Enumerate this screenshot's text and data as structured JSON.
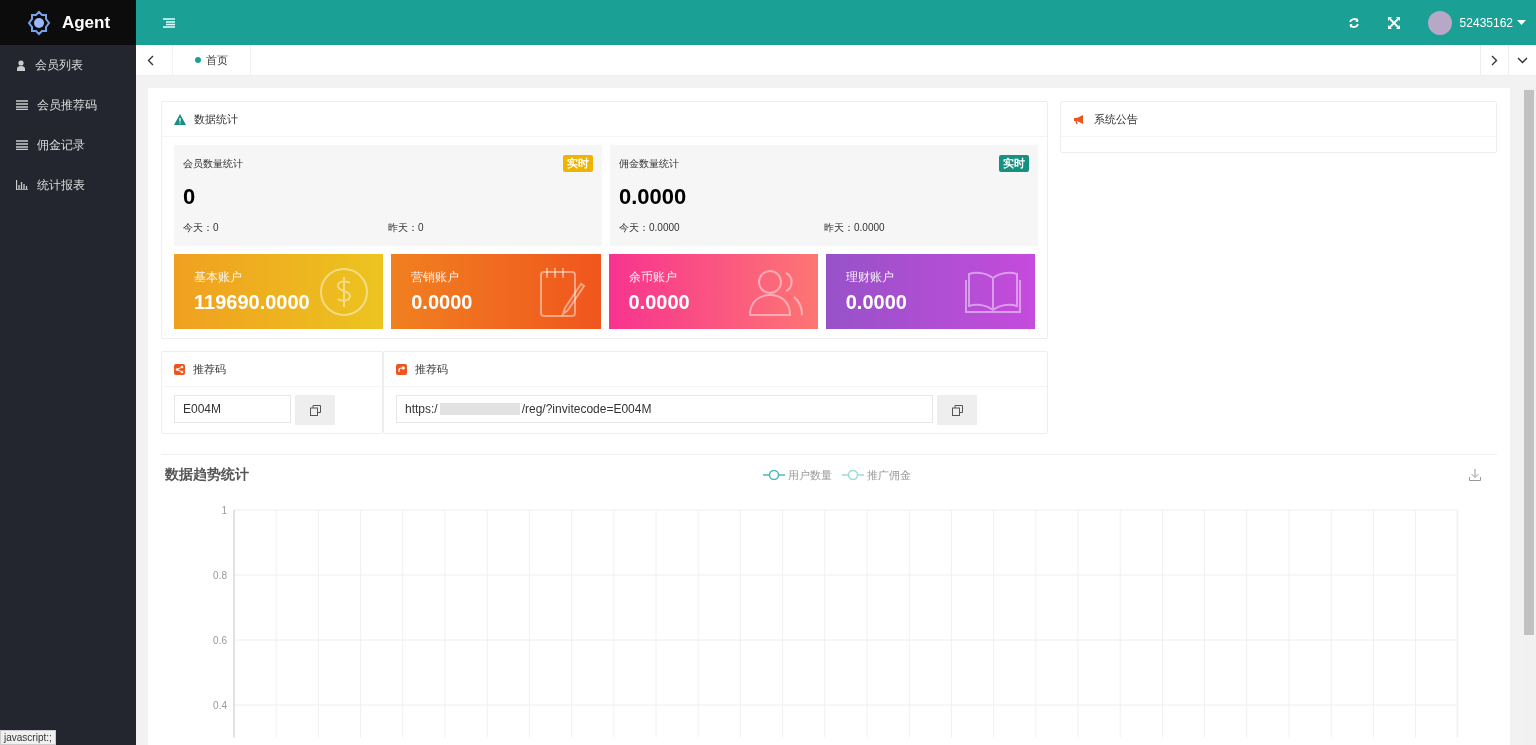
{
  "sidebar": {
    "brand": "Agent",
    "items": [
      {
        "label": "会员列表",
        "kind": "person",
        "selected": false
      },
      {
        "label": "会员推荐码",
        "kind": "list",
        "selected": false
      },
      {
        "label": "佣金记录",
        "kind": "list",
        "selected": false
      },
      {
        "label": "统计报表",
        "kind": "report",
        "selected": false
      }
    ]
  },
  "header": {
    "username": "52435162"
  },
  "tabs": [
    {
      "label": "首页",
      "selected": true
    }
  ],
  "stats_panel": {
    "title": "数据统计",
    "summaries": [
      {
        "title": "会员数量统计",
        "badge": "实时",
        "color": "#f0b400",
        "value": "0",
        "today": "今天：0",
        "yesterday": "昨天：0"
      },
      {
        "title": "佣金数量统计",
        "badge": "实时",
        "color": "#15917f",
        "value": "0.0000",
        "today": "今天：0.0000",
        "yesterday": "昨天：0.0000"
      }
    ],
    "accounts": [
      {
        "label": "基本账户",
        "value": "119690.0000",
        "kind": "coin"
      },
      {
        "label": "营销账户",
        "value": "0.0000",
        "kind": "notebook"
      },
      {
        "label": "余币账户",
        "value": "0.0000",
        "kind": "users"
      },
      {
        "label": "理财账户",
        "value": "0.0000",
        "kind": "book"
      }
    ]
  },
  "notice_panel": {
    "title": "系统公告"
  },
  "referral_code": {
    "title": "推荐码",
    "value": "E004M"
  },
  "referral_link": {
    "title": "推荐码",
    "value_start": "https:/",
    "value_end": "/reg/?invitecode=E004M"
  },
  "trend": {
    "title": "数据趋势统计",
    "chart_data": {
      "type": "line",
      "series": [
        {
          "name": "用户数量",
          "color": "#4bb7c1"
        },
        {
          "name": "推广佣金",
          "color": "#9adbd6"
        }
      ],
      "grid": true,
      "ylim": [
        0.3,
        1
      ],
      "yticks": [
        0.4,
        0.6,
        0.8,
        1
      ]
    }
  },
  "status_bar": {
    "text": "javascript:;"
  }
}
